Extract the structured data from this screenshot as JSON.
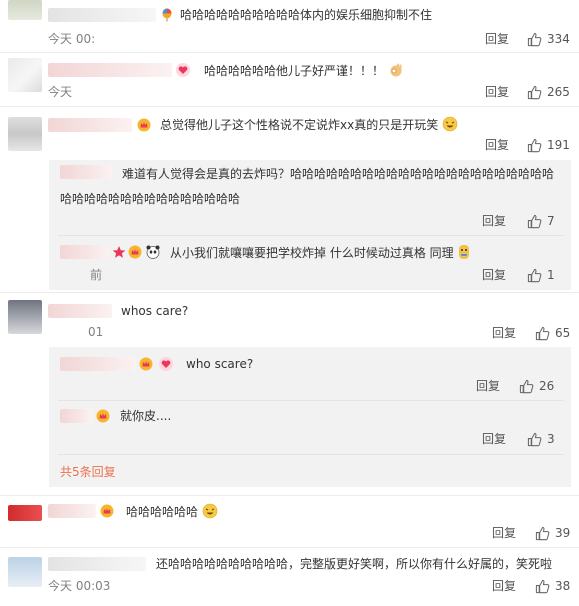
{
  "colors": {
    "accent": "#eb7350",
    "muted": "#808080",
    "reply_bg": "#f2f2f2"
  },
  "comments": [
    {
      "text": "哈哈哈哈哈哈哈哈哈哈体内的娱乐细胞抑制不住",
      "time": "今天 00:",
      "reply": "回复",
      "likes": "334"
    },
    {
      "text": "哈哈哈哈哈哈他儿子好严谨！！！",
      "time": "今天 ",
      "reply": "回复",
      "likes": "265"
    },
    {
      "text": "总觉得他儿子这个性格说不定说炸xx真的只是开玩笑",
      "time": "",
      "reply": "回复",
      "likes": "191",
      "replies": [
        {
          "text_line1": "难道有人觉得会是真的去炸吗？哈哈哈哈哈哈哈哈哈哈哈哈哈哈哈哈哈哈哈哈哈哈",
          "text_line2": "哈哈哈哈哈哈哈哈哈哈哈哈哈哈哈",
          "reply": "回复",
          "likes": "7"
        },
        {
          "text": "从小我们就嚷嚷要把学校炸掉 什么时候动过真格 同理",
          "time": "前",
          "reply": "回复",
          "likes": "1"
        }
      ]
    },
    {
      "text": "whos care?",
      "time": "01",
      "reply": "回复",
      "likes": "65",
      "replies": [
        {
          "text": "who scare?",
          "reply": "回复",
          "likes": "26"
        },
        {
          "text": "就你皮....",
          "reply": "回复",
          "likes": "3"
        }
      ],
      "more": "共5条回复"
    },
    {
      "text": "哈哈哈哈哈哈",
      "reply": "回复",
      "likes": "39"
    },
    {
      "text": "还哈哈哈哈哈哈哈哈哈哈，完整版更好笑啊，所以你有什么好属的，笑死啦",
      "time": "今天 00:03",
      "reply": "回复",
      "likes": "38"
    }
  ]
}
